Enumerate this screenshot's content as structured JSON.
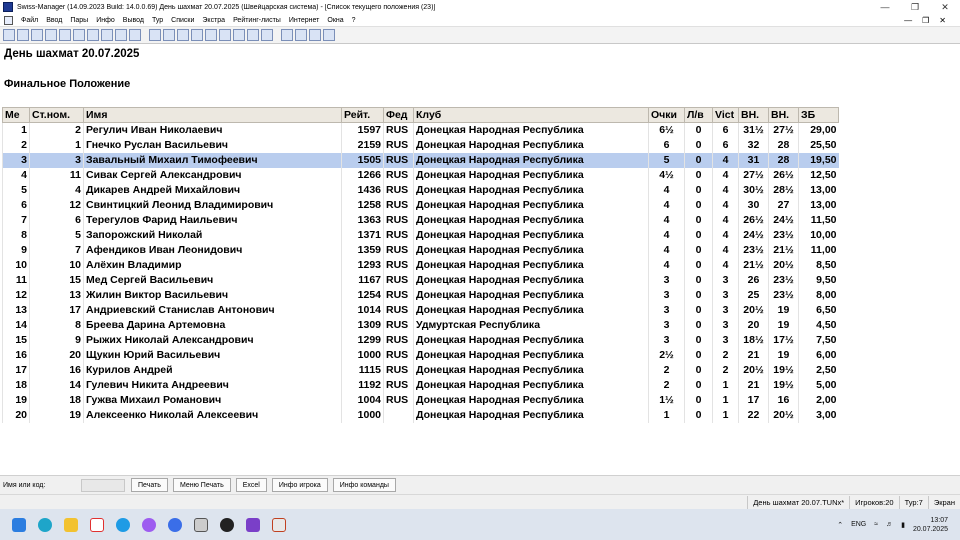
{
  "window": {
    "title": "Swiss-Manager (14.09.2023 Build: 14.0.0.69)  День шахмат 20.07.2025   (Швейцарская система) - [Список текущего положения (23)]"
  },
  "menu": {
    "items": [
      "Файл",
      "Ввод",
      "Пары",
      "Инфо",
      "Вывод",
      "Тур",
      "Списки",
      "Экстра",
      "Рейтинг-листы",
      "Интернет",
      "Окна",
      "?"
    ]
  },
  "report": {
    "title": "День шахмат 20.07.2025",
    "subtitle": "Финальное Положение"
  },
  "table": {
    "headers": [
      "Ме",
      "Ст.ном.",
      "Имя",
      "Рейт.",
      "Фед",
      "Клуб",
      "Очки",
      "Л/в",
      "Vict",
      "ВН.",
      "ВН.",
      "ЗБ"
    ],
    "selected_row": 2,
    "rows": [
      [
        "1",
        "2",
        "Регулич Иван Николаевич",
        "1597",
        "RUS",
        "Донецкая Народная Республика",
        "6½",
        "0",
        "6",
        "31½",
        "27½",
        "29,00"
      ],
      [
        "2",
        "1",
        "Гнечко Руслан Васильевич",
        "2159",
        "RUS",
        "Донецкая Народная Республика",
        "6",
        "0",
        "6",
        "32",
        "28",
        "25,50"
      ],
      [
        "3",
        "3",
        "Завальный Михаил Тимофеевич",
        "1505",
        "RUS",
        "Донецкая Народная Республика",
        "5",
        "0",
        "4",
        "31",
        "28",
        "19,50"
      ],
      [
        "4",
        "11",
        "Сивак Сергей Александрович",
        "1266",
        "RUS",
        "Донецкая Народная Республика",
        "4½",
        "0",
        "4",
        "27½",
        "26½",
        "12,50"
      ],
      [
        "5",
        "4",
        "Дикарев Андрей Михайлович",
        "1436",
        "RUS",
        "Донецкая Народная Республика",
        "4",
        "0",
        "4",
        "30½",
        "28½",
        "13,00"
      ],
      [
        "6",
        "12",
        "Свинтицкий Леонид Владимирович",
        "1258",
        "RUS",
        "Донецкая Народная Республика",
        "4",
        "0",
        "4",
        "30",
        "27",
        "13,00"
      ],
      [
        "7",
        "6",
        "Терегулов Фарид Наильевич",
        "1363",
        "RUS",
        "Донецкая Народная Республика",
        "4",
        "0",
        "4",
        "26½",
        "24½",
        "11,50"
      ],
      [
        "8",
        "5",
        "Запорожский Николай",
        "1371",
        "RUS",
        "Донецкая Народная Республика",
        "4",
        "0",
        "4",
        "24½",
        "23½",
        "10,00"
      ],
      [
        "9",
        "7",
        "Афендиков Иван Леонидович",
        "1359",
        "RUS",
        "Донецкая Народная Республика",
        "4",
        "0",
        "4",
        "23½",
        "21½",
        "11,00"
      ],
      [
        "10",
        "10",
        "Алёхин Владимир",
        "1293",
        "RUS",
        "Донецкая Народная Республика",
        "4",
        "0",
        "4",
        "21½",
        "20½",
        "8,50"
      ],
      [
        "11",
        "15",
        "Мед Сергей Васильевич",
        "1167",
        "RUS",
        "Донецкая Народная Республика",
        "3",
        "0",
        "3",
        "26",
        "23½",
        "9,50"
      ],
      [
        "12",
        "13",
        "Жилин Виктор Васильевич",
        "1254",
        "RUS",
        "Донецкая Народная Республика",
        "3",
        "0",
        "3",
        "25",
        "23½",
        "8,00"
      ],
      [
        "13",
        "17",
        "Андриевский Станислав Антонович",
        "1014",
        "RUS",
        "Донецкая Народная Республика",
        "3",
        "0",
        "3",
        "20½",
        "19",
        "6,50"
      ],
      [
        "14",
        "8",
        "Бреева Дарина Артемовна",
        "1309",
        "RUS",
        "Удмуртская Республика",
        "3",
        "0",
        "3",
        "20",
        "19",
        "4,50"
      ],
      [
        "15",
        "9",
        "Рыжих Николай Александрович",
        "1299",
        "RUS",
        "Донецкая Народная Республика",
        "3",
        "0",
        "3",
        "18½",
        "17½",
        "7,50"
      ],
      [
        "16",
        "20",
        "Щукин Юрий Васильевич",
        "1000",
        "RUS",
        "Донецкая Народная Республика",
        "2½",
        "0",
        "2",
        "21",
        "19",
        "6,00"
      ],
      [
        "17",
        "16",
        "Курилов Андрей",
        "1115",
        "RUS",
        "Донецкая Народная Республика",
        "2",
        "0",
        "2",
        "20½",
        "19½",
        "2,50"
      ],
      [
        "18",
        "14",
        "Гулевич Никита Андреевич",
        "1192",
        "RUS",
        "Донецкая Народная Республика",
        "2",
        "0",
        "1",
        "21",
        "19½",
        "5,00"
      ],
      [
        "19",
        "18",
        "Гужва Михаил Романович",
        "1004",
        "RUS",
        "Донецкая Народная Республика",
        "1½",
        "0",
        "1",
        "17",
        "16",
        "2,00"
      ],
      [
        "20",
        "19",
        "Алексеенко Николай Алексеевич",
        "1000",
        "",
        "Донецкая Народная Республика",
        "1",
        "0",
        "1",
        "22",
        "20½",
        "3,00"
      ]
    ]
  },
  "bottom": {
    "search_label": "Имя или код:",
    "search_value": "",
    "buttons": [
      "Печать",
      "Меню Печать",
      "Excel",
      "Инфо игрока",
      "Инфо команды"
    ]
  },
  "status": {
    "file": "День шахмат 20.07.TUNx*",
    "players": "Игроков:20",
    "round": "Тур:7",
    "mode": "Экран"
  },
  "taskbar": {
    "lang": "ENG",
    "time": "13:07",
    "date": "20.07.2025"
  },
  "colors": {
    "selected_row": "#b9cdee",
    "header_bg": "#ece8e0"
  }
}
